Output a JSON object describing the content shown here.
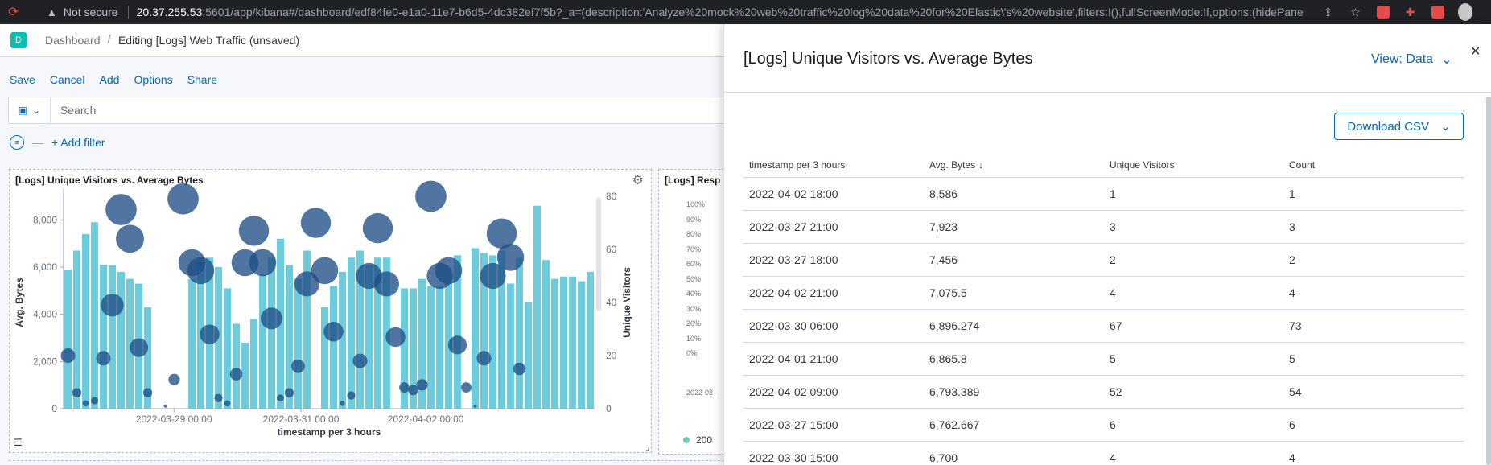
{
  "browser": {
    "not_secure": "Not secure",
    "url_host": "20.37.255.53",
    "url_rest": ":5601/app/kibana#/dashboard/edf84fe0-e1a0-11e7-b6d5-4dc382ef7f5b?_a=(description:'Analyze%20mock%20web%20traffic%20log%20data%20for%20Elastic\\'s%20website',filters:!(),fullScreenMode:!f,options:(hidePanelT..."
  },
  "header": {
    "logo_letter": "D",
    "breadcrumb_root": "Dashboard",
    "breadcrumb_current": "Editing [Logs] Web Traffic (unsaved)"
  },
  "menu": {
    "save": "Save",
    "cancel": "Cancel",
    "add": "Add",
    "options": "Options",
    "share": "Share"
  },
  "search": {
    "placeholder": "Search"
  },
  "filter": {
    "add_label": "+ Add filter"
  },
  "panel1": {
    "title": "[Logs] Unique Visitors vs. Average Bytes"
  },
  "panel2": {
    "title": "[Logs] Resp",
    "y_ticks": [
      "100%",
      "90%",
      "80%",
      "70%",
      "60%",
      "50%",
      "40%",
      "30%",
      "20%",
      "10%",
      "0%"
    ],
    "x_tick": "2022-03-",
    "legend": "200"
  },
  "chart_data": {
    "type": "bar",
    "title": "[Logs] Unique Visitors vs. Average Bytes",
    "xlabel": "timestamp per 3 hours",
    "ylabel": "Avg. Bytes",
    "y2label": "Unique Visitors",
    "ylim": [
      0,
      9000
    ],
    "y2lim": [
      0,
      80
    ],
    "y_ticks": [
      "0",
      "2,000",
      "4,000",
      "6,000",
      "8,000"
    ],
    "y2_ticks": [
      "0",
      "20",
      "40",
      "60",
      "80"
    ],
    "x_ticks": [
      "2022-03-29 00:00",
      "2022-03-31 00:00",
      "2022-04-02 00:00"
    ],
    "bar_color": "#6dccdc",
    "bubble_color": "#1f4e86",
    "series": [
      {
        "name": "Avg. Bytes",
        "values": [
          5900,
          6700,
          7400,
          7900,
          6100,
          6100,
          5800,
          5500,
          5300,
          4300,
          0,
          0,
          0,
          0,
          5500,
          6200,
          6400,
          6000,
          5100,
          3600,
          2800,
          3800,
          5700,
          6400,
          7200,
          6100,
          5500,
          6700,
          0,
          4300,
          5200,
          5800,
          6400,
          6700,
          6100,
          6400,
          6400,
          0,
          5100,
          5100,
          5500,
          5200,
          5200,
          5300,
          6500,
          0,
          6800,
          6600,
          6500,
          6700,
          5300,
          6400,
          4500,
          8600,
          6300,
          5500,
          5600,
          5600,
          5400,
          5800
        ]
      }
    ],
    "bubbles": [
      {
        "x": 0,
        "visitors": 20,
        "size": 14
      },
      {
        "x": 1,
        "visitors": 6,
        "size": 9
      },
      {
        "x": 2,
        "visitors": 2,
        "size": 6
      },
      {
        "x": 3,
        "visitors": 3,
        "size": 7
      },
      {
        "x": 4,
        "visitors": 19,
        "size": 14
      },
      {
        "x": 5,
        "visitors": 39,
        "size": 22
      },
      {
        "x": 6,
        "visitors": 75,
        "size": 30
      },
      {
        "x": 7,
        "visitors": 64,
        "size": 27
      },
      {
        "x": 8,
        "visitors": 23,
        "size": 18
      },
      {
        "x": 9,
        "visitors": 6,
        "size": 9
      },
      {
        "x": 11,
        "visitors": 1,
        "size": 3
      },
      {
        "x": 12,
        "visitors": 11,
        "size": 11
      },
      {
        "x": 13,
        "visitors": 79,
        "size": 30
      },
      {
        "x": 14,
        "visitors": 55,
        "size": 26
      },
      {
        "x": 15,
        "visitors": 52,
        "size": 26
      },
      {
        "x": 16,
        "visitors": 28,
        "size": 19
      },
      {
        "x": 17,
        "visitors": 4,
        "size": 8
      },
      {
        "x": 18,
        "visitors": 2,
        "size": 6
      },
      {
        "x": 19,
        "visitors": 13,
        "size": 12
      },
      {
        "x": 20,
        "visitors": 55,
        "size": 26
      },
      {
        "x": 21,
        "visitors": 67,
        "size": 29
      },
      {
        "x": 22,
        "visitors": 55,
        "size": 26
      },
      {
        "x": 23,
        "visitors": 34,
        "size": 21
      },
      {
        "x": 24,
        "visitors": 4,
        "size": 7
      },
      {
        "x": 25,
        "visitors": 6,
        "size": 9
      },
      {
        "x": 26,
        "visitors": 16,
        "size": 13
      },
      {
        "x": 27,
        "visitors": 47,
        "size": 24
      },
      {
        "x": 28,
        "visitors": 70,
        "size": 29
      },
      {
        "x": 29,
        "visitors": 52,
        "size": 26
      },
      {
        "x": 30,
        "visitors": 29,
        "size": 19
      },
      {
        "x": 31,
        "visitors": 2,
        "size": 5
      },
      {
        "x": 32,
        "visitors": 5,
        "size": 8
      },
      {
        "x": 33,
        "visitors": 18,
        "size": 14
      },
      {
        "x": 34,
        "visitors": 50,
        "size": 25
      },
      {
        "x": 35,
        "visitors": 68,
        "size": 29
      },
      {
        "x": 36,
        "visitors": 47,
        "size": 24
      },
      {
        "x": 37,
        "visitors": 27,
        "size": 19
      },
      {
        "x": 38,
        "visitors": 8,
        "size": 10
      },
      {
        "x": 39,
        "visitors": 7,
        "size": 10
      },
      {
        "x": 40,
        "visitors": 9,
        "size": 11
      },
      {
        "x": 41,
        "visitors": 80,
        "size": 30
      },
      {
        "x": 42,
        "visitors": 50,
        "size": 25
      },
      {
        "x": 43,
        "visitors": 52,
        "size": 26
      },
      {
        "x": 44,
        "visitors": 24,
        "size": 18
      },
      {
        "x": 45,
        "visitors": 8,
        "size": 10
      },
      {
        "x": 46,
        "visitors": 1,
        "size": 3
      },
      {
        "x": 47,
        "visitors": 19,
        "size": 14
      },
      {
        "x": 48,
        "visitors": 50,
        "size": 25
      },
      {
        "x": 49,
        "visitors": 66,
        "size": 29
      },
      {
        "x": 50,
        "visitors": 57,
        "size": 26
      },
      {
        "x": 51,
        "visitors": 15,
        "size": 12
      }
    ]
  },
  "flyout": {
    "title": "[Logs] Unique Visitors vs. Average Bytes",
    "view_label": "View: Data",
    "download_label": "Download CSV",
    "columns": [
      "timestamp per 3 hours",
      "Avg. Bytes",
      "Unique Visitors",
      "Count"
    ],
    "rows": [
      [
        "2022-04-02 18:00",
        "8,586",
        "1",
        "1"
      ],
      [
        "2022-03-27 21:00",
        "7,923",
        "3",
        "3"
      ],
      [
        "2022-03-27 18:00",
        "7,456",
        "2",
        "2"
      ],
      [
        "2022-04-02 21:00",
        "7,075.5",
        "4",
        "4"
      ],
      [
        "2022-03-30 06:00",
        "6,896.274",
        "67",
        "73"
      ],
      [
        "2022-04-01 21:00",
        "6,865.8",
        "5",
        "5"
      ],
      [
        "2022-04-02 09:00",
        "6,793.389",
        "52",
        "54"
      ],
      [
        "2022-03-27 15:00",
        "6,762.667",
        "6",
        "6"
      ],
      [
        "2022-03-30 15:00",
        "6,700",
        "4",
        "4"
      ]
    ]
  }
}
